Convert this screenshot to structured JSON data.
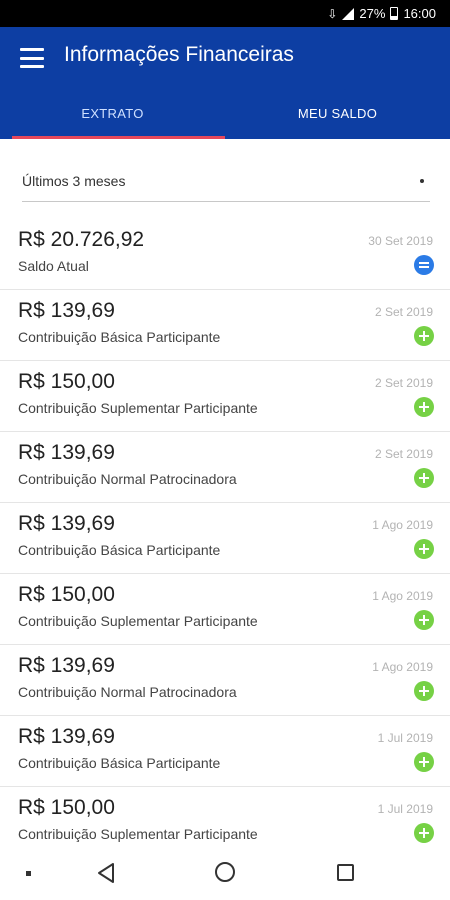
{
  "status_bar": {
    "battery": "27%",
    "time": "16:00"
  },
  "app_bar": {
    "title": "Informações Financeiras",
    "tabs": [
      {
        "label": "EXTRATO",
        "active": true
      },
      {
        "label": "MEU SALDO",
        "active": false
      }
    ]
  },
  "filter": {
    "selected": "Últimos 3 meses"
  },
  "transactions": [
    {
      "amount": "R$ 20.726,92",
      "description": "Saldo Atual",
      "date": "30 Set 2019",
      "icon": "equals-icon"
    },
    {
      "amount": "R$ 139,69",
      "description": "Contribuição Básica Participante",
      "date": "2 Set 2019",
      "icon": "plus-icon"
    },
    {
      "amount": "R$ 150,00",
      "description": "Contribuição Suplementar Participante",
      "date": "2 Set 2019",
      "icon": "plus-icon"
    },
    {
      "amount": "R$ 139,69",
      "description": "Contribuição Normal Patrocinadora",
      "date": "2 Set 2019",
      "icon": "plus-icon"
    },
    {
      "amount": "R$ 139,69",
      "description": "Contribuição Básica Participante",
      "date": "1 Ago 2019",
      "icon": "plus-icon"
    },
    {
      "amount": "R$ 150,00",
      "description": "Contribuição Suplementar Participante",
      "date": "1 Ago 2019",
      "icon": "plus-icon"
    },
    {
      "amount": "R$ 139,69",
      "description": "Contribuição Normal Patrocinadora",
      "date": "1 Ago 2019",
      "icon": "plus-icon"
    },
    {
      "amount": "R$ 139,69",
      "description": "Contribuição Básica Participante",
      "date": "1 Jul 2019",
      "icon": "plus-icon"
    },
    {
      "amount": "R$ 150,00",
      "description": "Contribuição Suplementar Participante",
      "date": "1 Jul 2019",
      "icon": "plus-icon"
    }
  ],
  "colors": {
    "app_bar": "#0d3ea3",
    "tab_indicator": "#e5485b",
    "plus_badge": "#76d145",
    "equals_badge": "#2b7be6"
  }
}
